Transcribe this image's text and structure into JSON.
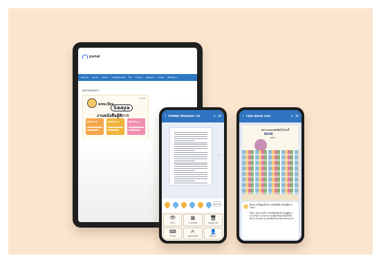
{
  "tablet": {
    "logo_text": "punai",
    "nav_items": [
      "หน้าแรก",
      "แนะนำ",
      "บริการ",
      "ร่วมเป็นสมาชิก",
      "รีวิว",
      "ข่าวสาร",
      "ติดต่อเรา",
      "บริจาค",
      "เกี่ยวกับเรา"
    ],
    "section_title": "ผลงานของเรา",
    "banner": {
      "logo": "punai",
      "line1": "ลงทะเบียน",
      "brand": "Saaya",
      "line2": "งานหนังสือผู้พิการ"
    },
    "cards": [
      {
        "label": "บัตรเข้างาน",
        "color": "#f3a64a"
      },
      {
        "label": "บัตรเข้างาน",
        "color": "#f0b43a"
      },
      {
        "label": "บัตรเข้างาน",
        "color": "#ef8fb0"
      }
    ]
  },
  "phone1": {
    "title": "PUNAI Member Ch",
    "back_icon": "back-arrow-icon",
    "hearts": [
      {
        "color": "#f4b23c"
      },
      {
        "color": "#6fb2e6"
      },
      {
        "color": "#f4b23c"
      },
      {
        "color": "#6fb2e6"
      },
      {
        "color": "#f4b23c"
      },
      {
        "color": "#6fb2e6"
      }
    ],
    "chip": "punai",
    "menu": [
      {
        "icon": "👁",
        "label": "บริการ"
      },
      {
        "icon": "▦",
        "label": "อ่านหนังสือ"
      },
      {
        "icon": "🖥",
        "label": "ข้อมูลสมาชิก"
      },
      {
        "icon": "⌨",
        "label": "เว็บไซต์"
      },
      {
        "icon": "✍",
        "label": "สมัครสมาชิก"
      },
      {
        "icon": "👤",
        "label": "ติดต่อเรา"
      }
    ]
  },
  "phone2": {
    "title": "Thai Book Fair",
    "poster": {
      "head": "สถานะของหนังสือในโลกนี้",
      "head2": "BOOK",
      "date": "2024"
    },
    "message": {
      "question": "ต้องการใช้ศูนย์บริการหนังสือสำหรับผู้พิการไหม?",
      "answer": "ได้ค่ะ ปุ่มนายบริการหนังสือเสียงสำหรับผู้พิการทางสายตา ท่านสามารถเลือกฟังหนังสือได้ทั้งนิยาย สารคดี และหนังสือเรียน ที่สมาชิกแนะนำ"
    }
  },
  "colors": {
    "background": "#fae5cf",
    "accent_blue": "#2f74c0"
  }
}
